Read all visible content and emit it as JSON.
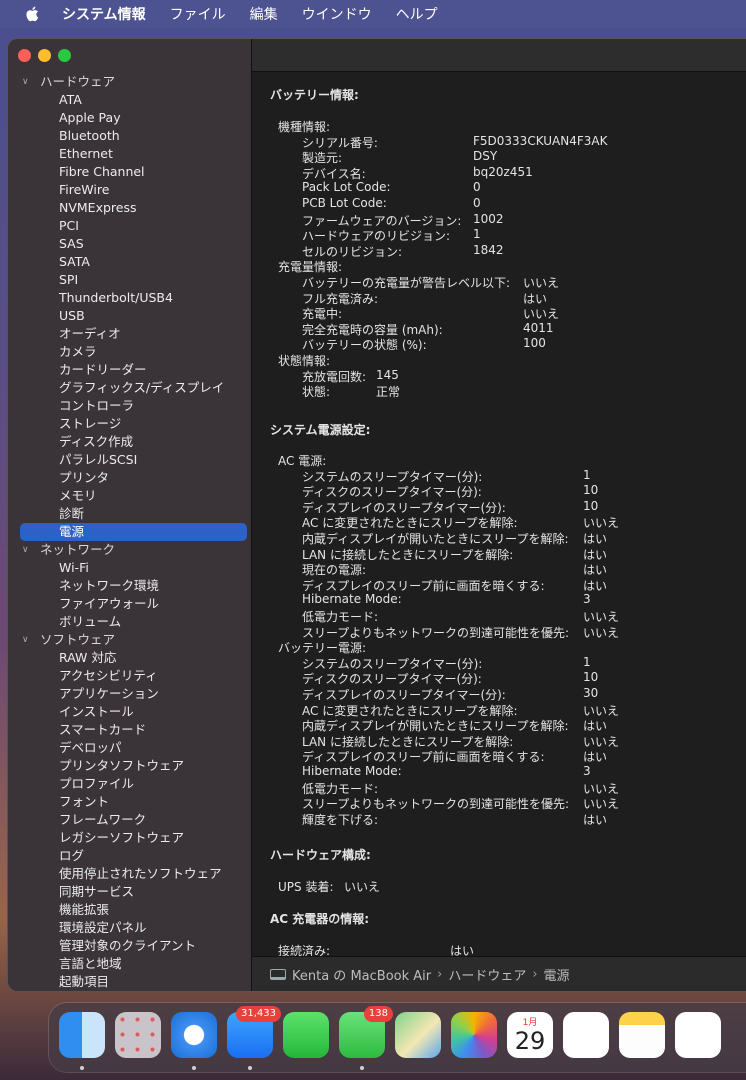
{
  "menubar": {
    "app_name": "システム情報",
    "items": [
      "ファイル",
      "編集",
      "ウインドウ",
      "ヘルプ"
    ]
  },
  "sidebar": {
    "categories": [
      {
        "label": "ハードウェア",
        "items": [
          "ATA",
          "Apple Pay",
          "Bluetooth",
          "Ethernet",
          "Fibre Channel",
          "FireWire",
          "NVMExpress",
          "PCI",
          "SAS",
          "SATA",
          "SPI",
          "Thunderbolt/USB4",
          "USB",
          "オーディオ",
          "カメラ",
          "カードリーダー",
          "グラフィックス/ディスプレイ",
          "コントローラ",
          "ストレージ",
          "ディスク作成",
          "パラレルSCSI",
          "プリンタ",
          "メモリ",
          "診断",
          "電源"
        ]
      },
      {
        "label": "ネットワーク",
        "items": [
          "Wi-Fi",
          "ネットワーク環境",
          "ファイアウォール",
          "ボリューム"
        ]
      },
      {
        "label": "ソフトウェア",
        "items": [
          "RAW 対応",
          "アクセシビリティ",
          "アプリケーション",
          "インストール",
          "スマートカード",
          "デベロッパ",
          "プリンタソフトウェア",
          "プロファイル",
          "フォント",
          "フレームワーク",
          "レガシーソフトウェア",
          "ログ",
          "使用停止されたソフトウェア",
          "同期サービス",
          "機能拡張",
          "環境設定パネル",
          "管理対象のクライアント",
          "言語と地域",
          "起動項目"
        ]
      }
    ],
    "selected": "電源"
  },
  "content": {
    "battery_title": "バッテリー情報:",
    "model_info": {
      "label": "機種情報:",
      "rows": [
        [
          "シリアル番号:",
          "F5D0333CKUAN4F3AK"
        ],
        [
          "製造元:",
          "DSY"
        ],
        [
          "デバイス名:",
          "bq20z451"
        ],
        [
          "Pack Lot Code:",
          "0"
        ],
        [
          "PCB Lot Code:",
          "0"
        ],
        [
          "ファームウェアのバージョン:",
          "1002"
        ],
        [
          "ハードウェアのリビジョン:",
          "1"
        ],
        [
          "セルのリビジョン:",
          "1842"
        ]
      ]
    },
    "charge_info": {
      "label": "充電量情報:",
      "rows": [
        [
          "バッテリーの充電量が警告レベル以下:",
          "いいえ"
        ],
        [
          "フル充電済み:",
          "はい"
        ],
        [
          "充電中:",
          "いいえ"
        ],
        [
          "完全充電時の容量 (mAh):",
          "4011"
        ],
        [
          "バッテリーの状態 (%):",
          "100"
        ]
      ]
    },
    "health_info": {
      "label": "状態情報:",
      "rows": [
        [
          "充放電回数:",
          "145"
        ],
        [
          "状態:",
          "正常"
        ]
      ]
    },
    "power_title": "システム電源設定:",
    "ac_power": {
      "label": "AC 電源:",
      "rows": [
        [
          "システムのスリープタイマー(分):",
          "1"
        ],
        [
          "ディスクのスリープタイマー(分):",
          "10"
        ],
        [
          "ディスプレイのスリープタイマー(分):",
          "10"
        ],
        [
          "AC に変更されたときにスリープを解除:",
          "いいえ"
        ],
        [
          "内蔵ディスプレイが開いたときにスリープを解除:",
          "はい"
        ],
        [
          "LAN に接続したときにスリープを解除:",
          "はい"
        ],
        [
          "現在の電源:",
          "はい"
        ],
        [
          "ディスプレイのスリープ前に画面を暗くする:",
          "はい"
        ],
        [
          "Hibernate Mode:",
          "3"
        ],
        [
          "低電力モード:",
          "いいえ"
        ],
        [
          "スリープよりもネットワークの到達可能性を優先:",
          "いいえ"
        ]
      ]
    },
    "battery_power": {
      "label": "バッテリー電源:",
      "rows": [
        [
          "システムのスリープタイマー(分):",
          "1"
        ],
        [
          "ディスクのスリープタイマー(分):",
          "10"
        ],
        [
          "ディスプレイのスリープタイマー(分):",
          "30"
        ],
        [
          "AC に変更されたときにスリープを解除:",
          "いいえ"
        ],
        [
          "内蔵ディスプレイが開いたときにスリープを解除:",
          "はい"
        ],
        [
          "LAN に接続したときにスリープを解除:",
          "いいえ"
        ],
        [
          "ディスプレイのスリープ前に画面を暗くする:",
          "はい"
        ],
        [
          "Hibernate Mode:",
          "3"
        ],
        [
          "低電力モード:",
          "いいえ"
        ],
        [
          "スリープよりもネットワークの到達可能性を優先:",
          "いいえ"
        ],
        [
          "輝度を下げる:",
          "はい"
        ]
      ]
    },
    "hardware_title": "ハードウェア構成:",
    "ups": [
      "UPS 装着:",
      "いいえ"
    ],
    "charger_title": "AC 充電器の情報:",
    "charger_rows": [
      [
        "接続済み:",
        "はい"
      ]
    ]
  },
  "pathbar": {
    "computer": "Kenta の MacBook Air",
    "section": "ハードウェア",
    "page": "電源"
  },
  "dock": {
    "apps": [
      "finder-icon",
      "launchpad-icon",
      "safari-icon",
      "mail-icon",
      "facetime-icon",
      "messages-icon",
      "maps-icon",
      "photos-icon",
      "calendar-icon",
      "reminders-icon",
      "notes-icon",
      "freeform-icon"
    ],
    "mail_badge": "31,433",
    "messages_badge": "138",
    "calendar_month": "1月",
    "calendar_day": "29"
  }
}
